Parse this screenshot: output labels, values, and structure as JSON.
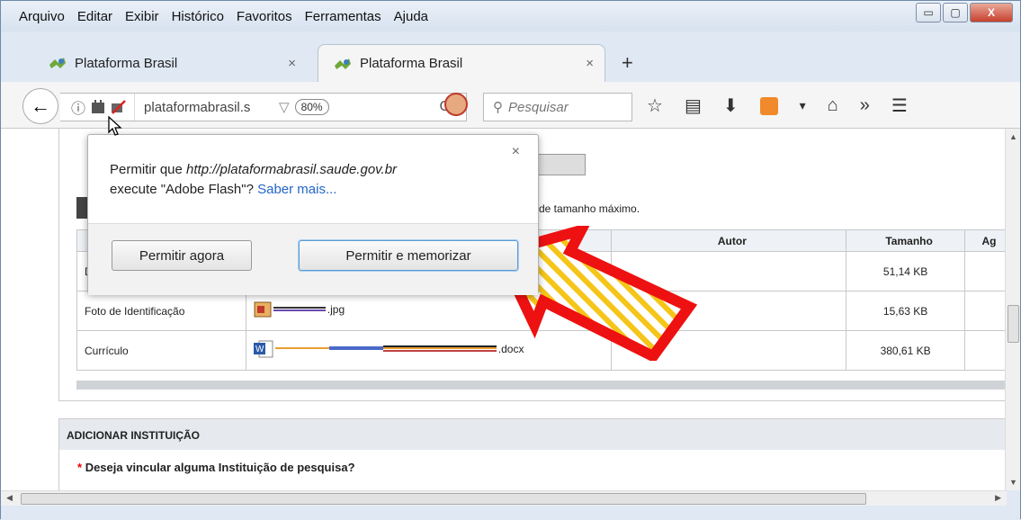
{
  "menu": {
    "items": [
      "Arquivo",
      "Editar",
      "Exibir",
      "Histórico",
      "Favoritos",
      "Ferramentas",
      "Ajuda"
    ]
  },
  "window_buttons": {
    "minimize": "▭",
    "maximize": "▢",
    "close": "X"
  },
  "tabs": [
    {
      "label": "Plataforma Brasil",
      "close": "×"
    },
    {
      "label": "Plataforma Brasil",
      "close": "×"
    }
  ],
  "newtab": "+",
  "nav": {
    "url": "plataformabrasil.s",
    "zoom": "80%",
    "search_placeholder": "Pesquisar",
    "info_icon": "ⓘ",
    "reload": "C",
    "dropdown": "▽"
  },
  "page": {
    "hint": "de tamanho máximo.",
    "table": {
      "headers": [
        "Autor",
        "Tamanho",
        "Ag"
      ],
      "rows": [
        {
          "type": "D",
          "file": "",
          "size": "51,14 KB"
        },
        {
          "type": "Foto de Identificação",
          "file": ".jpg",
          "size": "15,63 KB"
        },
        {
          "type": "Currículo",
          "file": ".docx",
          "size": "380,61 KB"
        }
      ]
    },
    "section_title": "ADICIONAR INSTITUIÇÃO",
    "question_req": "*",
    "question": "Deseja vincular alguma Instituição de pesquisa?"
  },
  "popup": {
    "text_prefix": "Permitir que ",
    "url": "http://plataformabrasil.saude.gov.br",
    "text_mid": "execute \"Adobe Flash\"? ",
    "learn_more": "Saber mais...",
    "close": "×",
    "btn_allow_now": "Permitir agora",
    "btn_allow_remember": "Permitir e memorizar"
  },
  "colors": {
    "arrow_red": "#ee1111",
    "arrow_stripe": "#f5c518",
    "link": "#2366c8"
  }
}
